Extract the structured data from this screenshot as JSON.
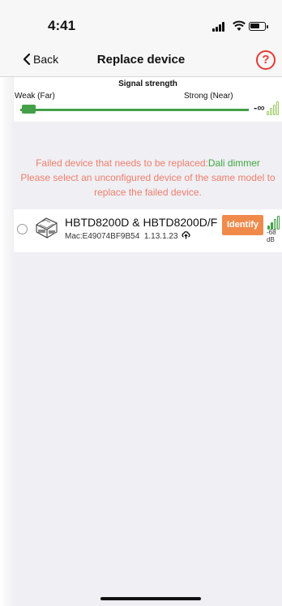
{
  "status_bar": {
    "time": "4:41"
  },
  "nav": {
    "back_label": "Back",
    "title": "Replace device",
    "help_symbol": "?"
  },
  "signal_strength": {
    "title": "Signal strength",
    "weak_label": "Weak (Far)",
    "strong_label": "Strong (Near)",
    "value_label": "-∞"
  },
  "notice": {
    "prefix": "Failed device that needs to be replaced:",
    "device_type": "Dali dimmer",
    "instruction": "Please select an unconfigured device of the same model to replace the failed device."
  },
  "devices": [
    {
      "name": "HBTD8200D & HBTD8200D/F",
      "mac": "Mac:E49074BF9B54",
      "version": "1.13.1.23",
      "identify_label": "Identify",
      "rssi": "-68 dB"
    }
  ],
  "colors": {
    "accent_green": "#43a047",
    "notice_red": "#ef7e6a",
    "identify_orange": "#f08a4b",
    "help_red": "#e53935"
  }
}
